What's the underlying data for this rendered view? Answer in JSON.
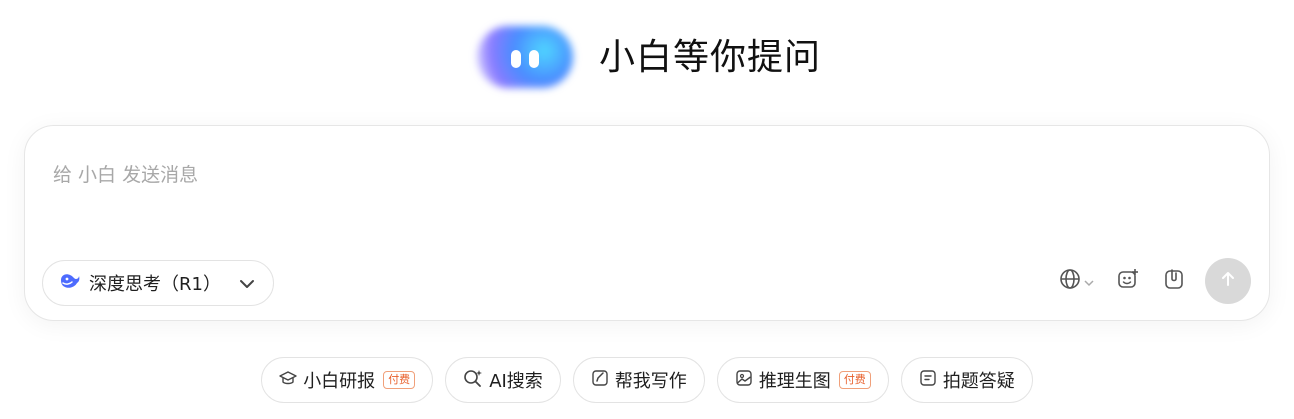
{
  "header": {
    "title": "小白等你提问",
    "logo_icon": "smiling-blob-logo"
  },
  "composer": {
    "placeholder": "给 小白 发送消息",
    "value": "",
    "deep_think": {
      "icon": "whale-icon",
      "label": "深度思考（R1）"
    },
    "tools": [
      "globe-icon",
      "image-plus-icon",
      "attach-icon"
    ],
    "send_icon": "arrow-up-icon"
  },
  "chips": [
    {
      "icon": "graduation-cap-icon",
      "label": "小白研报",
      "badge": "付费"
    },
    {
      "icon": "ai-search-icon",
      "label": "AI搜索"
    },
    {
      "icon": "edit-icon",
      "label": "帮我写作"
    },
    {
      "icon": "image-icon",
      "label": "推理生图",
      "badge": "付费"
    },
    {
      "icon": "doc-icon",
      "label": "拍题答疑"
    }
  ],
  "colors": {
    "accent": "#4a8dff",
    "badge": "#e8602c",
    "send_disabled": "#d9d9d9",
    "whale": "#4d6bfe"
  }
}
